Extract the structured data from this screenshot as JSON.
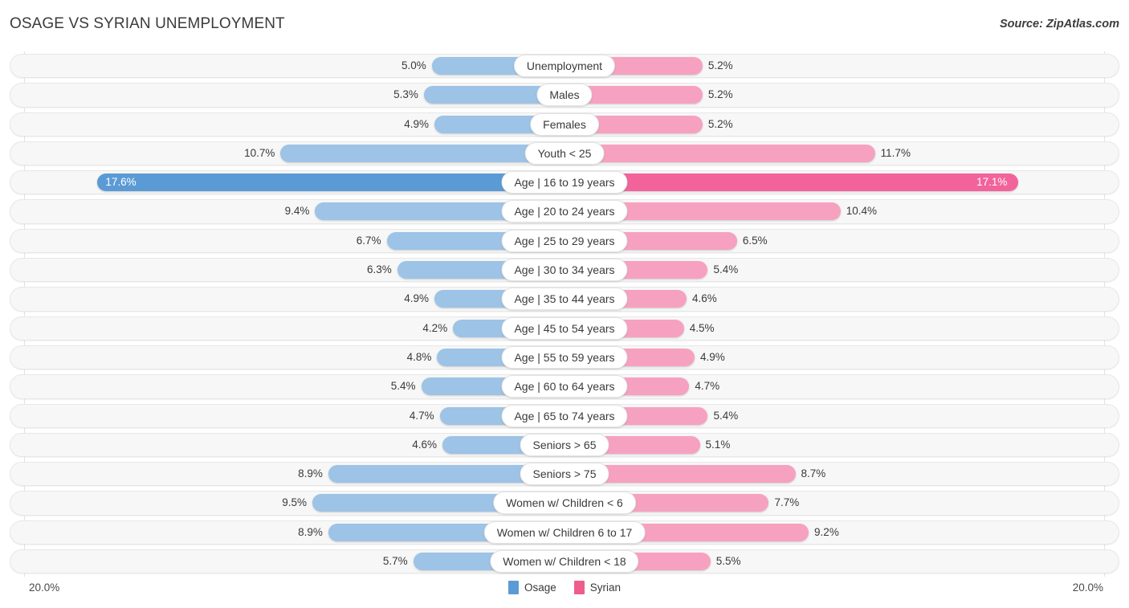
{
  "header": {
    "title": "OSAGE VS SYRIAN UNEMPLOYMENT",
    "source": "Source: ZipAtlas.com"
  },
  "legend": {
    "items": [
      {
        "label": "Osage",
        "color": "#5b9bd5"
      },
      {
        "label": "Syrian",
        "color": "#ee5e8c"
      }
    ]
  },
  "axis": {
    "left_end": "20.0%",
    "right_end": "20.0%",
    "max": 20.0
  },
  "colors": {
    "left_normal": "#9dc3e6",
    "left_highlight": "#5b9bd5",
    "right_normal": "#f7a1c0",
    "right_highlight": "#f2639b",
    "track": "#f7f7f7",
    "gridline": "#e2e2e2"
  },
  "chart_data": {
    "type": "bar",
    "title": "OSAGE VS SYRIAN UNEMPLOYMENT",
    "subtitle": "",
    "xlabel": "",
    "ylabel": "",
    "orientation": "horizontal-diverging",
    "xlim": [
      0,
      20
    ],
    "grid": false,
    "legend_position": "bottom-center",
    "categories": [
      "Unemployment",
      "Males",
      "Females",
      "Youth < 25",
      "Age | 16 to 19 years",
      "Age | 20 to 24 years",
      "Age | 25 to 29 years",
      "Age | 30 to 34 years",
      "Age | 35 to 44 years",
      "Age | 45 to 54 years",
      "Age | 55 to 59 years",
      "Age | 60 to 64 years",
      "Age | 65 to 74 years",
      "Seniors > 65",
      "Seniors > 75",
      "Women w/ Children < 6",
      "Women w/ Children 6 to 17",
      "Women w/ Children < 18"
    ],
    "series": [
      {
        "name": "Osage",
        "side": "left",
        "values": [
          5.0,
          5.3,
          4.9,
          10.7,
          17.6,
          9.4,
          6.7,
          6.3,
          4.9,
          4.2,
          4.8,
          5.4,
          4.7,
          4.6,
          8.9,
          9.5,
          8.9,
          5.7
        ],
        "labels": [
          "5.0%",
          "5.3%",
          "4.9%",
          "10.7%",
          "17.6%",
          "9.4%",
          "6.7%",
          "6.3%",
          "4.9%",
          "4.2%",
          "4.8%",
          "5.4%",
          "4.7%",
          "4.6%",
          "8.9%",
          "9.5%",
          "8.9%",
          "5.7%"
        ]
      },
      {
        "name": "Syrian",
        "side": "right",
        "values": [
          5.2,
          5.2,
          5.2,
          11.7,
          17.1,
          10.4,
          6.5,
          5.4,
          4.6,
          4.5,
          4.9,
          4.7,
          5.4,
          5.1,
          8.7,
          7.7,
          9.2,
          5.5
        ],
        "labels": [
          "5.2%",
          "5.2%",
          "5.2%",
          "11.7%",
          "17.1%",
          "10.4%",
          "6.5%",
          "5.4%",
          "4.6%",
          "4.5%",
          "4.9%",
          "4.7%",
          "5.4%",
          "5.1%",
          "8.7%",
          "7.7%",
          "9.2%",
          "5.5%"
        ]
      }
    ],
    "highlight_row_index": 4
  }
}
